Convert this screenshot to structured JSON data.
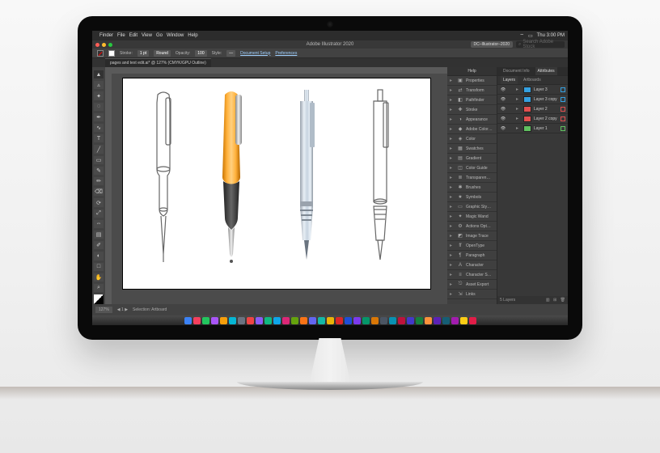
{
  "mac_menu": {
    "apple": "",
    "items": [
      "Finder",
      "File",
      "Edit",
      "View",
      "Go",
      "Window",
      "Help"
    ],
    "right": {
      "clock": "Thu 3:00 PM"
    }
  },
  "app": {
    "title": "Adobe Illustrator 2020",
    "workspace_chip": "DC–Illustrator–2020",
    "search_placeholder": "Search Adobe Stock"
  },
  "control": {
    "stroke_label": "Stroke:",
    "stroke_weight": "1 pt",
    "stroke_profile": "Round",
    "opacity_label": "Opacity:",
    "opacity_value": "100",
    "style_label": "Style:",
    "doc_setup": "Document Setup",
    "preferences": "Preferences"
  },
  "document_tab": "pages and text edit.ai* @ 127% (CMYK/GPU Outline)",
  "status": {
    "zoom": "127%",
    "artboard_label": "Selection: Artboard"
  },
  "panel_tabs_top": [
    "Document Info",
    "Attributes"
  ],
  "panel_strip": {
    "header": "Help",
    "items": [
      {
        "icon": "▣",
        "label": "Properties"
      },
      {
        "icon": "⇄",
        "label": "Transform"
      },
      {
        "icon": "◧",
        "label": "Pathfinder"
      },
      {
        "icon": "✚",
        "label": "Stroke"
      },
      {
        "icon": "◑",
        "label": "Appearance"
      },
      {
        "icon": "◆",
        "label": "Adobe Color…"
      },
      {
        "icon": "◈",
        "label": "Color"
      },
      {
        "icon": "▦",
        "label": "Swatches"
      },
      {
        "icon": "▤",
        "label": "Gradient"
      },
      {
        "icon": "◫",
        "label": "Color Guide"
      },
      {
        "icon": "≣",
        "label": "Transparen…"
      },
      {
        "icon": "✱",
        "label": "Brushes"
      },
      {
        "icon": "★",
        "label": "Symbols"
      },
      {
        "icon": "▭",
        "label": "Graphic Sty…"
      },
      {
        "icon": "✦",
        "label": "Magic Wand"
      },
      {
        "icon": "⚙",
        "label": "Actions Opt…"
      },
      {
        "icon": "◩",
        "label": "Image Trace"
      },
      {
        "icon": "ff",
        "label": "OpenType"
      },
      {
        "icon": "¶",
        "label": "Paragraph"
      },
      {
        "icon": "A",
        "label": "Character"
      },
      {
        "icon": "≡",
        "label": "Character S…"
      },
      {
        "icon": "⎋",
        "label": "Asset Export"
      },
      {
        "icon": "⇲",
        "label": "Links"
      }
    ]
  },
  "layers_panel": {
    "tabs": [
      "Layers",
      "Artboards"
    ],
    "active_tab": "Layers",
    "layers": [
      {
        "name": "Layer 3",
        "color": "#35a0e0",
        "visible": true
      },
      {
        "name": "Layer 3 copy",
        "color": "#35a0e0",
        "visible": true
      },
      {
        "name": "Layer 2",
        "color": "#e05050",
        "visible": true
      },
      {
        "name": "Layer 2 copy",
        "color": "#e05050",
        "visible": true
      },
      {
        "name": "Layer 1",
        "color": "#60c060",
        "visible": true
      }
    ],
    "footer": "5 Layers"
  },
  "tools": [
    "sel",
    "dsel",
    "wand",
    "lasso",
    "pen",
    "curv",
    "type",
    "line",
    "rect",
    "brush",
    "pencil",
    "eraser",
    "rotate",
    "scale",
    "width",
    "warp",
    "shape",
    "grad",
    "eyedrop",
    "blend",
    "slice",
    "artb",
    "hand",
    "zoom",
    "fillstroke"
  ],
  "dock_colors": [
    "#3b82f6",
    "#f43f5e",
    "#22c55e",
    "#a855f7",
    "#f59e0b",
    "#06b6d4",
    "#6b7280",
    "#ef4444",
    "#8b5cf6",
    "#10b981",
    "#0ea5e9",
    "#db2777",
    "#65a30d",
    "#f97316",
    "#6366f1",
    "#14b8a6",
    "#eab308",
    "#dc2626",
    "#1d4ed8",
    "#7c3aed",
    "#059669",
    "#d97706",
    "#4b5563",
    "#0891b2",
    "#be123c",
    "#4338ca",
    "#15803d",
    "#fb923c",
    "#5b21b6",
    "#155e75",
    "#a21caf",
    "#facc15",
    "#e11d48"
  ]
}
